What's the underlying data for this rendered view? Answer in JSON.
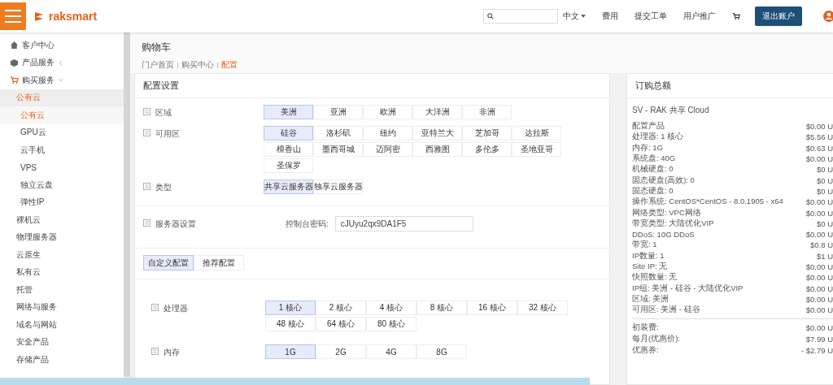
{
  "header": {
    "logo": "raksmart",
    "language": "中文",
    "links": [
      "费用",
      "提交工单",
      "用户推广"
    ],
    "logout": "退出账户"
  },
  "sidebar": {
    "items": [
      {
        "label": "客户中心",
        "selected": false
      },
      {
        "label": "产品服务",
        "selected": false,
        "expanded": false
      },
      {
        "label": "购买服务",
        "selected": false,
        "expanded": true,
        "children": [
          {
            "label": "公有云",
            "selected": true,
            "children": [
              {
                "label": "公有云",
                "selected": true
              },
              {
                "label": "GPU云",
                "selected": false
              },
              {
                "label": "云手机",
                "selected": false
              },
              {
                "label": "VPS",
                "selected": false
              },
              {
                "label": "独立云盘",
                "selected": false
              },
              {
                "label": "弹性IP",
                "selected": false
              }
            ]
          },
          {
            "label": "裸机云",
            "selected": false
          },
          {
            "label": "物理服务器",
            "selected": false
          },
          {
            "label": "云原生",
            "selected": false
          },
          {
            "label": "私有云",
            "selected": false
          },
          {
            "label": "托管",
            "selected": false
          },
          {
            "label": "网络与服务",
            "selected": false
          },
          {
            "label": "域名与网站",
            "selected": false
          },
          {
            "label": "安全产品",
            "selected": false
          },
          {
            "label": "存储产品",
            "selected": false
          }
        ]
      }
    ]
  },
  "page": {
    "title": "购物车",
    "breadcrumb": [
      {
        "label": "门户首页",
        "current": false
      },
      {
        "label": "购买中心",
        "current": false
      },
      {
        "label": "配置",
        "current": true
      }
    ]
  },
  "config": {
    "title": "配置设置",
    "rows": [
      {
        "kind": "options",
        "label": "区域",
        "options": [
          {
            "label": "美洲",
            "selected": true
          },
          {
            "label": "亚洲",
            "selected": false
          },
          {
            "label": "欧洲",
            "selected": false
          },
          {
            "label": "大洋洲",
            "selected": false
          },
          {
            "label": "非洲",
            "selected": false
          }
        ]
      },
      {
        "kind": "options",
        "label": "可用区",
        "options": [
          {
            "label": "硅谷",
            "selected": true
          },
          {
            "label": "洛杉矶",
            "selected": false
          },
          {
            "label": "纽约",
            "selected": false
          },
          {
            "label": "亚特兰大",
            "selected": false
          },
          {
            "label": "芝加哥",
            "selected": false
          },
          {
            "label": "达拉斯",
            "selected": false
          },
          {
            "label": "檀香山",
            "selected": false
          },
          {
            "label": "墨西哥城",
            "selected": false
          },
          {
            "label": "迈阿密",
            "selected": false
          },
          {
            "label": "西雅图",
            "selected": false
          },
          {
            "label": "多伦多",
            "selected": false
          },
          {
            "label": "圣地亚哥",
            "selected": false
          },
          {
            "label": "圣保罗",
            "selected": false
          }
        ]
      },
      {
        "kind": "options",
        "label": "类型",
        "options": [
          {
            "label": "共享云服务器",
            "selected": true
          },
          {
            "label": "独享云服务器",
            "selected": false
          }
        ]
      },
      {
        "kind": "field",
        "label": "服务器设置",
        "field_label": "控制台密码:",
        "value": "cJUyu2qx9DA1F5"
      }
    ],
    "tabs": [
      {
        "label": "自定义配置",
        "selected": true
      },
      {
        "label": "推荐配置",
        "selected": false
      }
    ],
    "specs": [
      {
        "label": "处理器",
        "options": [
          {
            "label": "1 核心",
            "selected": true
          },
          {
            "label": "2 核心",
            "selected": false
          },
          {
            "label": "4 核心",
            "selected": false
          },
          {
            "label": "8 核心",
            "selected": false
          },
          {
            "label": "16 核心",
            "selected": false
          },
          {
            "label": "32 核心",
            "selected": false
          },
          {
            "label": "48 核心",
            "selected": false
          },
          {
            "label": "64 核心",
            "selected": false
          },
          {
            "label": "80 核心",
            "selected": false
          }
        ]
      },
      {
        "label": "内存",
        "options": [
          {
            "label": "1G",
            "selected": true
          },
          {
            "label": "2G",
            "selected": false
          },
          {
            "label": "4G",
            "selected": false
          },
          {
            "label": "8G",
            "selected": false
          }
        ]
      }
    ]
  },
  "summary": {
    "title": "订购总额",
    "product": "SV - RAK 共享 Cloud",
    "lines": [
      {
        "label": "配置产品",
        "price": "$0.00 U"
      },
      {
        "label": "处理器: 1 核心",
        "price": "$5.56 U"
      },
      {
        "label": "内存: 1G",
        "price": "$0.63 U"
      },
      {
        "label": "系统盘: 40G",
        "price": "$0.00 U"
      },
      {
        "label": "机械硬盘: 0",
        "price": "$0 U"
      },
      {
        "label": "固态硬盘(高效): 0",
        "price": "$0 U"
      },
      {
        "label": "固态硬盘: 0",
        "price": "$0 U"
      },
      {
        "label": "操作系统: CentOS*CentOS - 8.0.1905 - x64",
        "price": "$0.00 U"
      },
      {
        "label": "网络类型: VPC网络",
        "price": "$0.00 U"
      },
      {
        "label": "带宽类型: 大陆优化VIP",
        "price": "$0 U"
      },
      {
        "label": "DDoS: 10G DDoS",
        "price": "$0.00 U"
      },
      {
        "label": "带宽: 1",
        "price": "$0.8 U"
      },
      {
        "label": "IP数量: 1",
        "price": "$1 U"
      },
      {
        "label": "Site IP: 无",
        "price": "$0.00 U"
      },
      {
        "label": "快照数量: 无",
        "price": "$0.00 U"
      },
      {
        "label": "IP组: 美洲 - 硅谷 - 大陆优化VIP",
        "price": "$0.00 U"
      },
      {
        "label": "区域: 美洲",
        "price": "$0.00 U"
      },
      {
        "label": "可用区: 美洲 - 硅谷",
        "price": "$0.00 U"
      }
    ],
    "totals": [
      {
        "label": "初装费:",
        "price": "$0.00 U"
      },
      {
        "label": "每月(优惠价):",
        "price": "$7.99 U"
      },
      {
        "label": "优惠券:",
        "price": "- $2.79 U"
      }
    ]
  }
}
